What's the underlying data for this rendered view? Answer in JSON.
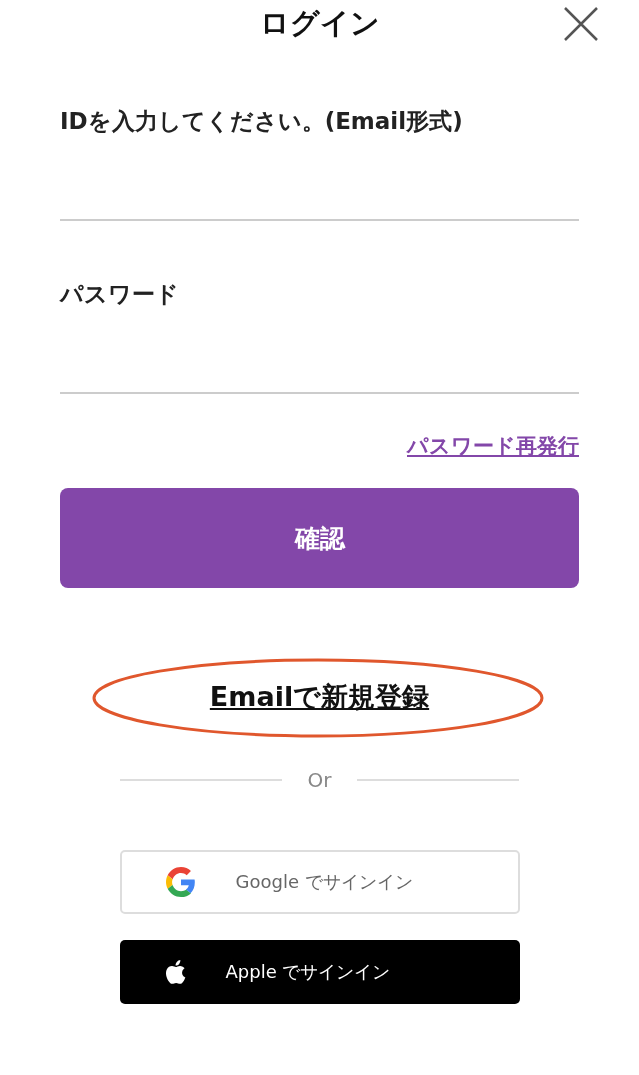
{
  "header": {
    "title": "ログイン"
  },
  "id_field": {
    "label": "IDを入力してください。(Email形式)"
  },
  "password_field": {
    "label": "パスワード"
  },
  "reset_link": "パスワード再発行",
  "confirm_button": "確認",
  "signup_link": {
    "text": "Emailで新規登録",
    "highlighted": true
  },
  "divider": "Or",
  "social_buttons": [
    {
      "kind": "google",
      "label": "Google でサインイン"
    },
    {
      "kind": "apple",
      "label": "Apple でサインイン"
    }
  ]
}
